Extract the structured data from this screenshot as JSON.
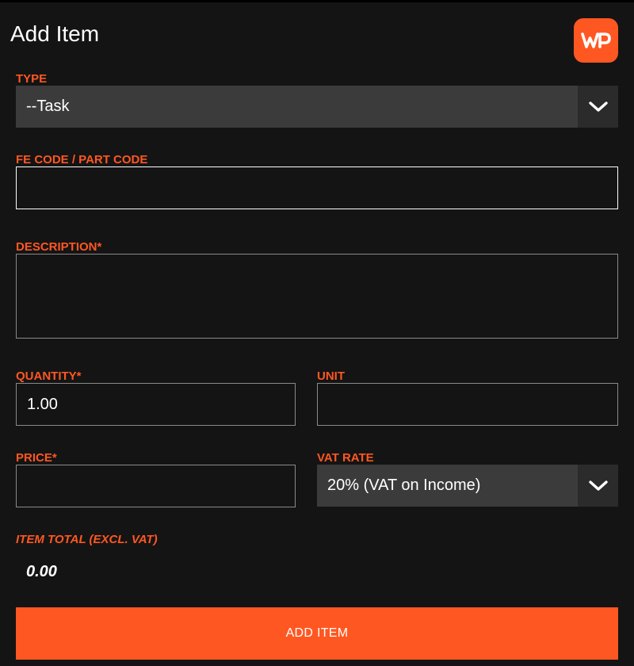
{
  "header": {
    "title": "Add Item",
    "logo_text": "WP",
    "logo_icon": "wp-logo-icon"
  },
  "colors": {
    "accent": "#ff5722",
    "background": "#141414",
    "select_bg": "#3b3b3b",
    "chevron_bg": "#2b2b2b",
    "text": "#ffffff"
  },
  "form": {
    "type": {
      "label": "TYPE",
      "value": "--Task",
      "icon": "chevron-down-icon"
    },
    "code": {
      "label": "FE CODE / PART CODE",
      "value": "",
      "placeholder": ""
    },
    "description": {
      "label": "DESCRIPTION*",
      "value": "",
      "placeholder": ""
    },
    "quantity": {
      "label": "QUANTITY*",
      "value": "1.00"
    },
    "unit": {
      "label": "UNIT",
      "value": ""
    },
    "price": {
      "label": "PRICE*",
      "value": ""
    },
    "vat_rate": {
      "label": "VAT RATE",
      "value": "20% (VAT on Income)",
      "icon": "chevron-down-icon"
    },
    "item_total": {
      "label": "ITEM TOTAL (EXCL. VAT)",
      "value": "0.00"
    }
  },
  "actions": {
    "add_item_label": "ADD ITEM"
  }
}
